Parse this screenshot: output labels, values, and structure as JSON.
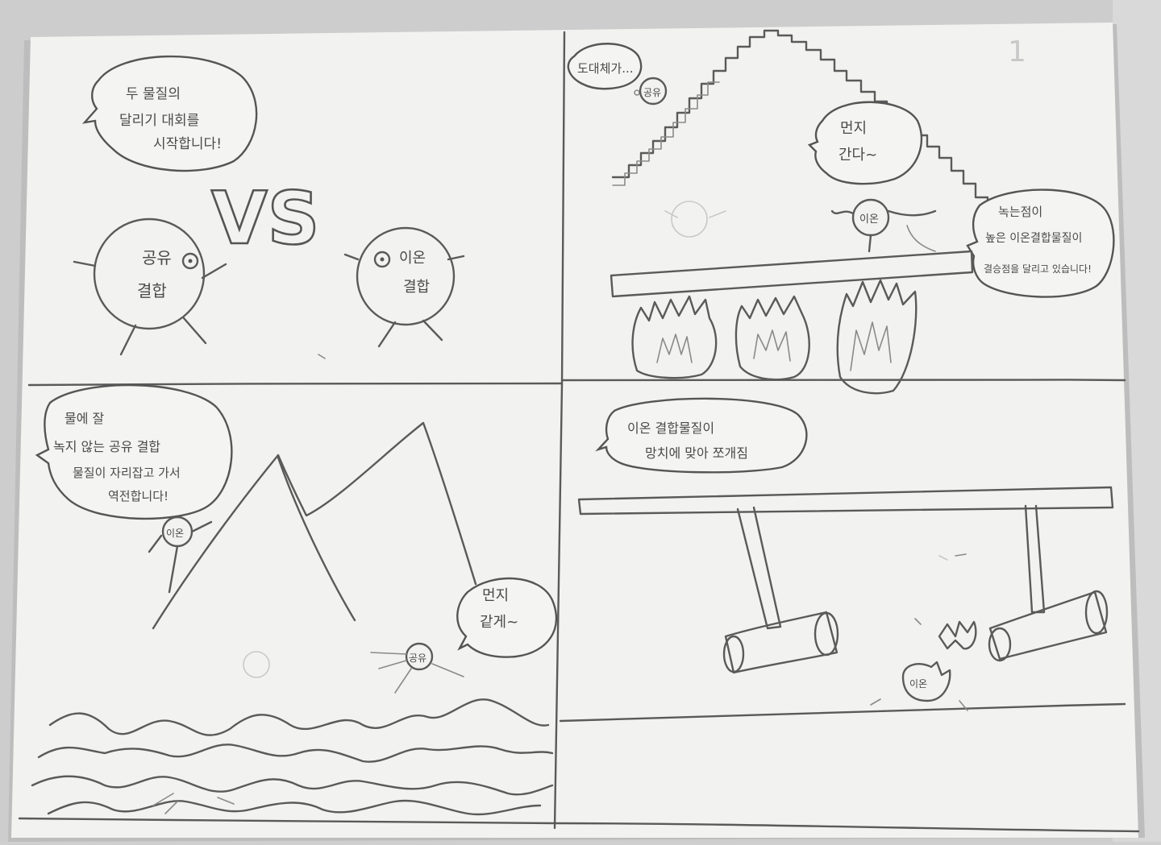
{
  "page_number": "1",
  "vs_text": "VS",
  "panel1": {
    "narration": [
      "두 물질의",
      "달리기 대회를",
      "시작합니다!"
    ],
    "covalent_label": [
      "공유",
      "결합"
    ],
    "ionic_label": [
      "이온",
      "결합"
    ]
  },
  "panel2": {
    "narration": [
      "물에 잘",
      "녹지 않는 공유 결합",
      "물질이 자리잡고 가서",
      "역전합니다!"
    ],
    "ionic_char": "이온",
    "covalent_speech": [
      "먼지",
      "같게~"
    ],
    "covalent_char": "공유"
  },
  "panel3": {
    "thought": "도대체가...",
    "covalent_char": "공유",
    "ionic_speech": [
      "먼지",
      "간다~"
    ],
    "ionic_char": "이온",
    "narration": [
      "녹는점이",
      "높은 이온결합물질이",
      "결승점을 달리고 있습니다!"
    ]
  },
  "panel4": {
    "narration": [
      "이온 결합물질이",
      "망치에 맞아 쪼개짐"
    ],
    "ionic_char": "이온"
  }
}
